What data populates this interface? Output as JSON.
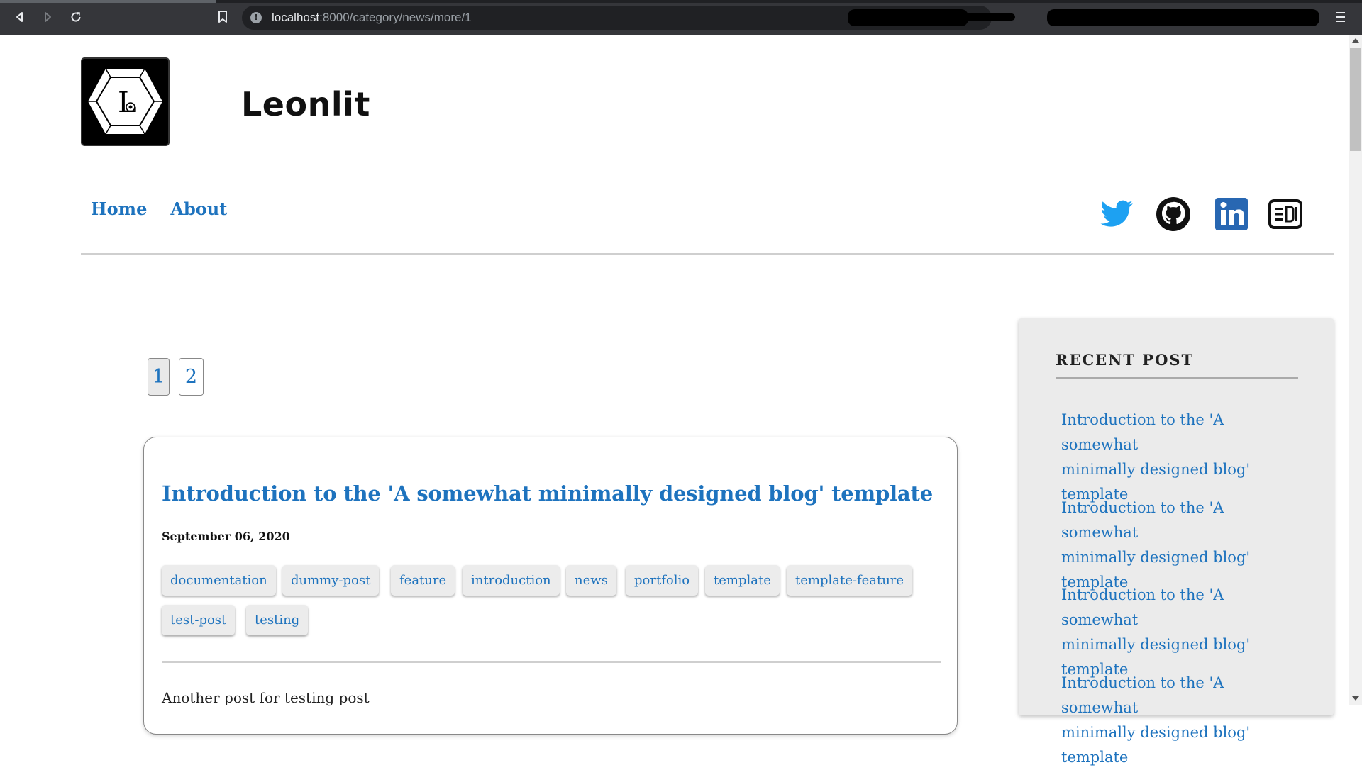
{
  "browser": {
    "url_host": "localhost",
    "url_path": ":8000/category/news/more/1"
  },
  "site": {
    "title": "Leonlit",
    "logo_letter": "L"
  },
  "nav": [
    {
      "label": "Home"
    },
    {
      "label": "About"
    }
  ],
  "social_icons": [
    "twitter-icon",
    "github-icon",
    "linkedin-icon",
    "dev-icon"
  ],
  "pagination": {
    "pages": [
      "1",
      "2"
    ],
    "current": "1"
  },
  "post": {
    "title": "Introduction to the 'A somewhat minimally designed blog' template",
    "date": "September 06, 2020",
    "tags": [
      "documentation",
      "dummy-post",
      "feature",
      "introduction",
      "news",
      "portfolio",
      "template",
      "template-feature",
      "test-post",
      "testing"
    ],
    "excerpt": "Another post for testing post"
  },
  "sidebar": {
    "heading": "RECENT POST",
    "items": [
      {
        "line1": "Introduction to the 'A somewhat",
        "line2": "minimally designed blog'",
        "line3": "template"
      },
      {
        "line1": "Introduction to the 'A somewhat",
        "line2": "minimally designed blog'",
        "line3": "template"
      },
      {
        "line1": "Introduction to the 'A somewhat",
        "line2": "minimally designed blog'",
        "line3": "template"
      },
      {
        "line1": "Introduction to the 'A somewhat",
        "line2": "minimally designed blog'",
        "line3": "template"
      }
    ]
  },
  "colors": {
    "link": "#1e73be",
    "twitter": "#1da1f2",
    "linkedin": "#2867b2"
  }
}
